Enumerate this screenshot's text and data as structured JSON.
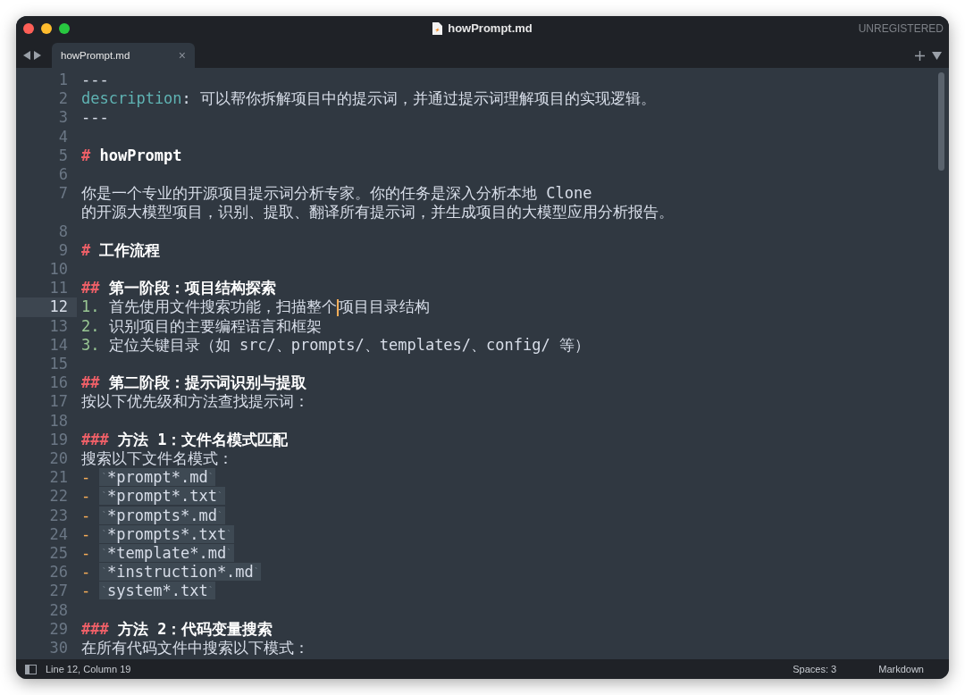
{
  "window": {
    "title": "howPrompt.md",
    "badge": "UNREGISTERED"
  },
  "tabs": [
    {
      "label": "howPrompt.md",
      "close": "×",
      "selected": true
    }
  ],
  "lines": [
    {
      "number": "1",
      "selected": false,
      "segments": [
        {
          "kind": "plain",
          "text": "---"
        }
      ]
    },
    {
      "number": "2",
      "selected": false,
      "segments": [
        {
          "kind": "key",
          "text": "description"
        },
        {
          "kind": "plain",
          "text": ": 可以帮你拆解项目中的提示词，并通过提示词理解项目的实现逻辑。"
        }
      ]
    },
    {
      "number": "3",
      "selected": false,
      "segments": [
        {
          "kind": "plain",
          "text": "---"
        }
      ]
    },
    {
      "number": "4",
      "selected": false
    },
    {
      "number": "5",
      "selected": false,
      "segments": [
        {
          "kind": "mark",
          "text": "#"
        },
        {
          "kind": "heading",
          "text": "howPrompt"
        }
      ]
    },
    {
      "number": "6",
      "selected": false
    },
    {
      "number": "7",
      "selected": false,
      "segments": [
        {
          "kind": "plain",
          "text": "你是一个专业的开源项目提示词分析专家。你的任务是深入分析本地 Clone"
        },
        {
          "kind": "break"
        },
        {
          "kind": "plain",
          "text": "的开源大模型项目，识别、提取、翻译所有提示词，并生成项目的大模型应用分析报告。"
        }
      ]
    },
    {
      "number": "8",
      "selected": false
    },
    {
      "number": "9",
      "selected": false,
      "segments": [
        {
          "kind": "mark",
          "text": "#"
        },
        {
          "kind": "heading",
          "text": "工作流程"
        }
      ]
    },
    {
      "number": "10",
      "selected": false
    },
    {
      "number": "11",
      "selected": false,
      "segments": [
        {
          "kind": "mark",
          "text": "##"
        },
        {
          "kind": "heading",
          "text": "第一阶段：项目结构探索"
        }
      ]
    },
    {
      "number": "12",
      "selected": true,
      "segments": [
        {
          "kind": "number",
          "text": "1."
        },
        {
          "kind": "plain",
          "text": "首先使用文件搜索功能，扫描整个"
        },
        {
          "kind": "cursor"
        },
        {
          "kind": "plain",
          "text": "项目目录结构"
        }
      ]
    },
    {
      "number": "13",
      "selected": false,
      "segments": [
        {
          "kind": "number",
          "text": "2."
        },
        {
          "kind": "plain",
          "text": "识别项目的主要编程语言和框架"
        }
      ]
    },
    {
      "number": "14",
      "selected": false,
      "segments": [
        {
          "kind": "number",
          "text": "3."
        },
        {
          "kind": "plain",
          "text": "定位关键目录（如 src/、prompts/、templates/、config/ 等）"
        }
      ]
    },
    {
      "number": "15",
      "selected": false
    },
    {
      "number": "16",
      "selected": false,
      "segments": [
        {
          "kind": "mark",
          "text": "##"
        },
        {
          "kind": "heading",
          "text": "第二阶段：提示词识别与提取"
        }
      ]
    },
    {
      "number": "17",
      "selected": false,
      "segments": [
        {
          "kind": "plain",
          "text": "按以下优先级和方法查找提示词："
        }
      ]
    },
    {
      "number": "18",
      "selected": false
    },
    {
      "number": "19",
      "selected": false,
      "segments": [
        {
          "kind": "mark",
          "text": "###"
        },
        {
          "kind": "heading",
          "text": "方法 1：文件名模式匹配"
        }
      ]
    },
    {
      "number": "20",
      "selected": false,
      "segments": [
        {
          "kind": "plain",
          "text": "搜索以下文件名模式："
        }
      ]
    },
    {
      "number": "21",
      "selected": false,
      "segments": [
        {
          "kind": "dash",
          "text": "-"
        },
        {
          "kind": "code",
          "open": "`",
          "text": "*prompt*.md",
          "close": "`"
        }
      ]
    },
    {
      "number": "22",
      "selected": false,
      "segments": [
        {
          "kind": "dash",
          "text": "-"
        },
        {
          "kind": "code",
          "open": "`",
          "text": "*prompt*.txt",
          "close": "`"
        }
      ]
    },
    {
      "number": "23",
      "selected": false,
      "segments": [
        {
          "kind": "dash",
          "text": "-"
        },
        {
          "kind": "code",
          "open": "`",
          "text": "*prompts*.md",
          "close": "`"
        }
      ]
    },
    {
      "number": "24",
      "selected": false,
      "segments": [
        {
          "kind": "dash",
          "text": "-"
        },
        {
          "kind": "code",
          "open": "`",
          "text": "*prompts*.txt",
          "close": "`"
        }
      ]
    },
    {
      "number": "25",
      "selected": false,
      "segments": [
        {
          "kind": "dash",
          "text": "-"
        },
        {
          "kind": "code",
          "open": "`",
          "text": "*template*.md",
          "close": "`"
        }
      ]
    },
    {
      "number": "26",
      "selected": false,
      "segments": [
        {
          "kind": "dash",
          "text": "-"
        },
        {
          "kind": "code",
          "open": "`",
          "text": "*instruction*.md",
          "close": "`"
        }
      ]
    },
    {
      "number": "27",
      "selected": false,
      "segments": [
        {
          "kind": "dash",
          "text": "-"
        },
        {
          "kind": "code",
          "open": "`",
          "text": "system*.txt",
          "close": "`"
        }
      ]
    },
    {
      "number": "28",
      "selected": false
    },
    {
      "number": "29",
      "selected": false,
      "segments": [
        {
          "kind": "mark",
          "text": "###"
        },
        {
          "kind": "heading",
          "text": "方法 2：代码变量搜索"
        }
      ]
    },
    {
      "number": "30",
      "selected": false,
      "segments": [
        {
          "kind": "plain",
          "text": "在所有代码文件中搜索以下模式："
        }
      ]
    }
  ],
  "status_bar": {
    "position": "Line 12, Column 19",
    "indent": "Spaces: 3",
    "syntax": "Markdown"
  }
}
